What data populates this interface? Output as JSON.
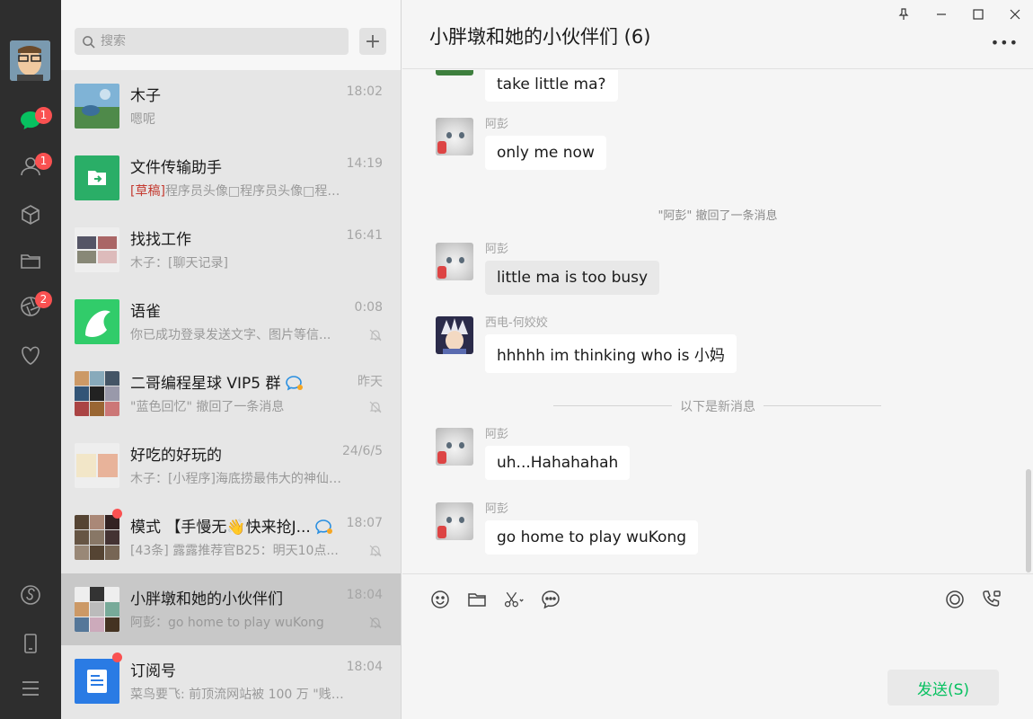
{
  "nav": {
    "badges": {
      "chats": "1",
      "contacts": "1",
      "moments": "2"
    }
  },
  "search": {
    "placeholder": "搜索",
    "add_label": "+"
  },
  "conversations": [
    {
      "name": "木子",
      "time": "18:02",
      "preview": "嗯呢"
    },
    {
      "name": "文件传输助手",
      "time": "14:19",
      "draft_tag": "[草稿]",
      "preview": "程序员头像□程序员头像□程序员..."
    },
    {
      "name": "找找工作",
      "time": "16:41",
      "preview": "木子：[聊天记录]"
    },
    {
      "name": "语雀",
      "time": "0:08",
      "preview": "你已成功登录发送文字、图片等信..."
    },
    {
      "name": "二哥编程星球 VIP5 群",
      "time": "昨天",
      "preview": "\"蓝色回忆\" 撤回了一条消息"
    },
    {
      "name": "好吃的好玩的",
      "time": "24/6/5",
      "preview": "木子：[小程序]海底捞最伟大的神仙蘸..."
    },
    {
      "name": "模式 【手慢无👋快来抢J...",
      "time": "18:07",
      "preview": "[43条] 露露推荐官B25：明天10点..."
    },
    {
      "name": "小胖墩和她的小伙伴们",
      "time": "18:04",
      "preview": "阿彭：go home to play wuKong"
    },
    {
      "name": "订阅号",
      "time": "18:04",
      "preview": "菜鸟要飞: 前顶流网站被 100 万 \"贱卖..."
    }
  ],
  "chat": {
    "title": "小胖墩和她的小伙伴们 (6)",
    "messages": [
      {
        "sender": "",
        "text": "take little ma?"
      },
      {
        "sender": "阿彭",
        "text": "only me now"
      },
      {
        "sender": "阿彭",
        "text": "little ma is too busy"
      },
      {
        "sender": "西电-何姣姣",
        "text": "hhhhh im thinking who is 小妈"
      },
      {
        "sender": "阿彭",
        "text": "uh...Hahahahah"
      },
      {
        "sender": "阿彭",
        "text": "go home to play wuKong"
      }
    ],
    "system_recall": "\"阿彭\" 撤回了一条消息",
    "new_divider": "以下是新消息",
    "send_label": "发送(S)"
  },
  "colors": {
    "accent": "#07c160",
    "badge": "#fa5151",
    "nav_bg": "#2e2e2e"
  }
}
